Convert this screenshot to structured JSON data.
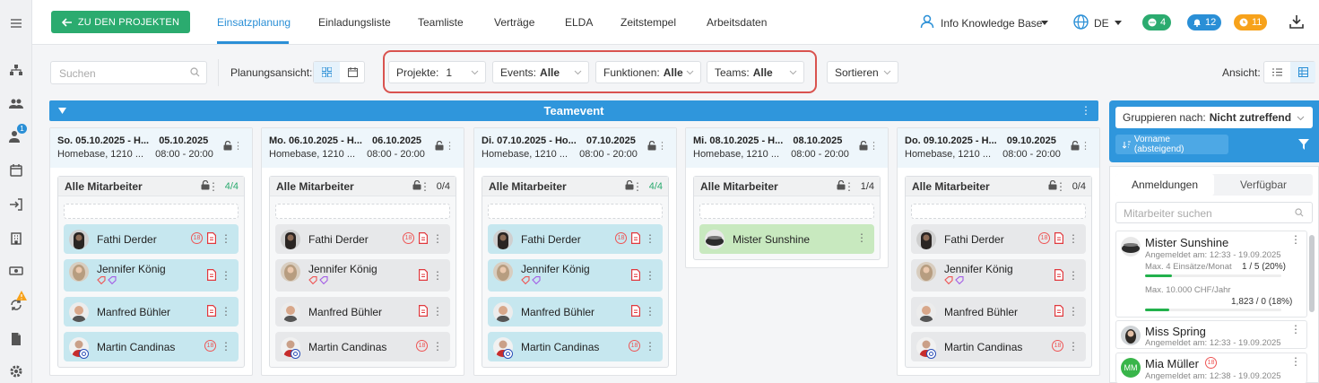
{
  "header": {
    "back_label": "ZU DEN PROJEKTEN",
    "tabs": [
      {
        "label": "Einsatzplanung",
        "active": true
      },
      {
        "label": "Einladungsliste"
      },
      {
        "label": "Teamliste"
      },
      {
        "label": "Verträge"
      },
      {
        "label": "ELDA"
      },
      {
        "label": "Zeitstempel"
      },
      {
        "label": "Arbeitsdaten"
      }
    ],
    "user": "Info Knowledge Base",
    "language": "DE",
    "badges": {
      "chat": "4",
      "bell": "12",
      "clock": "11"
    },
    "colors": {
      "accent": "#2a8fd6",
      "green": "#2bab6f",
      "orange": "#f7a21b"
    }
  },
  "sidebar": {
    "notify_count": "1"
  },
  "filters": {
    "search_placeholder": "Suchen",
    "planning_label": "Planungsansicht:",
    "projects": {
      "label": "Projekte:",
      "value": "1"
    },
    "events": {
      "label": "Events:",
      "value": "Alle"
    },
    "functions": {
      "label": "Funktionen:",
      "value": "Alle"
    },
    "teams": {
      "label": "Teams:",
      "value": "Alle"
    },
    "sort_label": "Sortieren",
    "view_label": "Ansicht:"
  },
  "team_event": {
    "title": "Teamevent"
  },
  "columns": [
    {
      "title": "So. 05.10.2025 - H...",
      "date": "05.10.2025",
      "location": "Homebase, 1210 ...",
      "time": "08:00 - 20:00",
      "group_label": "Alle Mitarbeiter",
      "count": "4/4",
      "persons": [
        {
          "name": "Fathi Derder",
          "assigned": true,
          "age": "18",
          "pdf": true
        },
        {
          "name": "Jennifer König",
          "assigned": true,
          "pdf": true,
          "tags": true
        },
        {
          "name": "Manfred Bühler",
          "assigned": true,
          "pdf": true
        },
        {
          "name": "Martin Candinas",
          "assigned": true,
          "age": "18"
        }
      ]
    },
    {
      "title": "Mo. 06.10.2025 - H...",
      "date": "06.10.2025",
      "location": "Homebase, 1210 ...",
      "time": "08:00 - 20:00",
      "group_label": "Alle Mitarbeiter",
      "count": "0/4",
      "persons": [
        {
          "name": "Fathi Derder",
          "assigned": false,
          "age": "18",
          "pdf": true
        },
        {
          "name": "Jennifer König",
          "assigned": false,
          "pdf": true,
          "tags": true
        },
        {
          "name": "Manfred Bühler",
          "assigned": false,
          "pdf": true
        },
        {
          "name": "Martin Candinas",
          "assigned": false,
          "age": "18"
        }
      ]
    },
    {
      "title": "Di. 07.10.2025 - Ho...",
      "date": "07.10.2025",
      "location": "Homebase, 1210 ...",
      "time": "08:00 - 20:00",
      "group_label": "Alle Mitarbeiter",
      "count": "4/4",
      "persons": [
        {
          "name": "Fathi Derder",
          "assigned": true,
          "age": "18",
          "pdf": true
        },
        {
          "name": "Jennifer König",
          "assigned": true,
          "pdf": true,
          "tags": true
        },
        {
          "name": "Manfred Bühler",
          "assigned": true,
          "pdf": true
        },
        {
          "name": "Martin Candinas",
          "assigned": true,
          "age": "18"
        }
      ]
    },
    {
      "title": "Mi. 08.10.2025 - H...",
      "date": "08.10.2025",
      "location": "Homebase, 1210 ...",
      "time": "08:00 - 20:00",
      "group_label": "Alle Mitarbeiter",
      "count": "1/4",
      "persons": [
        {
          "name": "Mister Sunshine",
          "green": true
        }
      ]
    },
    {
      "title": "Do. 09.10.2025 - H...",
      "date": "09.10.2025",
      "location": "Homebase, 1210 ...",
      "time": "08:00 - 20:00",
      "group_label": "Alle Mitarbeiter",
      "count": "0/4",
      "persons": [
        {
          "name": "Fathi Derder",
          "assigned": false,
          "age": "18",
          "pdf": true
        },
        {
          "name": "Jennifer König",
          "assigned": false,
          "pdf": true,
          "tags": true
        },
        {
          "name": "Manfred Bühler",
          "assigned": false,
          "pdf": true
        },
        {
          "name": "Martin Candinas",
          "assigned": false,
          "age": "18"
        }
      ]
    }
  ],
  "right_panel": {
    "group_by_label": "Gruppieren nach:",
    "group_by_value": "Nicht zutreffend",
    "sort_chip": "Vorname (absteigend)",
    "tabs": [
      "Anmeldungen",
      "Verfügbar"
    ],
    "search_placeholder": "Mitarbeiter suchen",
    "cards": [
      {
        "name": "Mister Sunshine",
        "registered": "Angemeldet am: 12:33 - 19.09.2025",
        "limit1_label": "Max. 4 Einsätze/Monat",
        "limit1_value": "1 / 5 (20%)",
        "limit1_fill": 0.2,
        "limit2_label": "Max. 10.000 CHF/Jahr",
        "limit2_value": "1,823 / 0 (18%)",
        "limit2_fill": 0.18
      },
      {
        "name": "Miss Spring",
        "registered": "Angemeldet am: 12:33 - 19.09.2025"
      },
      {
        "name": "Mia Müller",
        "initials": "MM",
        "age": "18",
        "registered": "Angemeldet am: 12:38 - 19.09.2025"
      }
    ]
  }
}
